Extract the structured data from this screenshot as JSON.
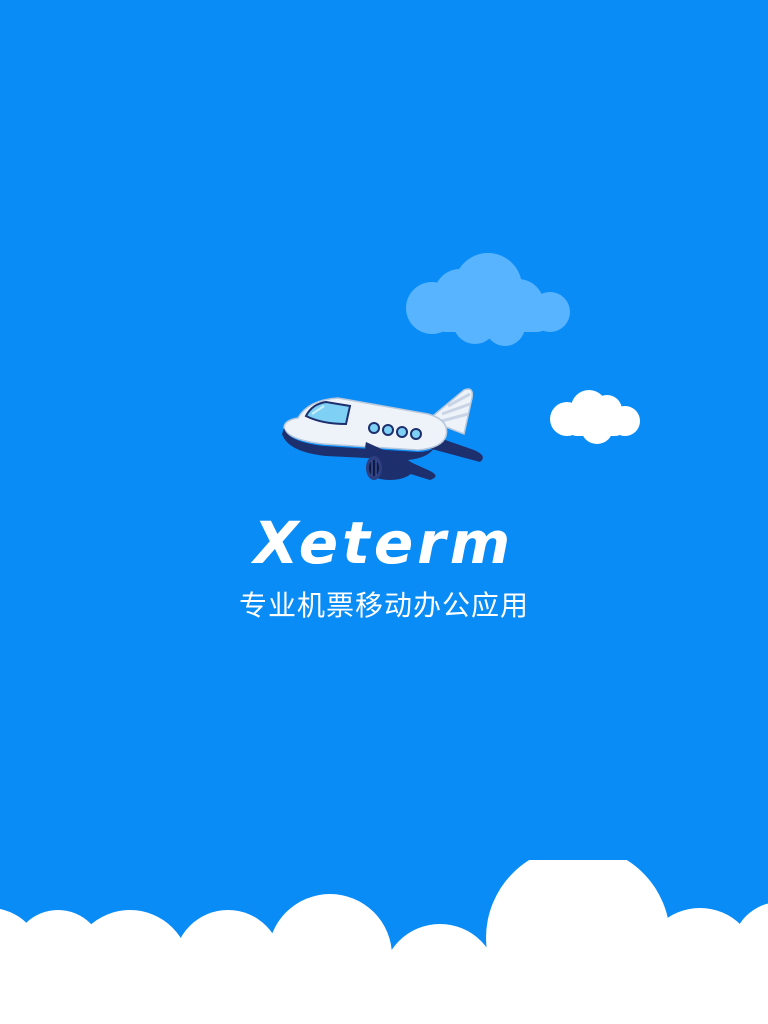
{
  "app": {
    "name": "Xeterm",
    "tagline": "专业机票移动办公应用"
  },
  "colors": {
    "background": "#0a8cf7",
    "cloud_light": "#59b4ff",
    "cloud_white": "#ffffff",
    "plane_body": "#eef3f9",
    "plane_navy": "#1e2f6d",
    "plane_window": "#7fd0f5"
  },
  "icons": {
    "plane": "airplane-illustration",
    "clouds": "cloud-illustration"
  }
}
